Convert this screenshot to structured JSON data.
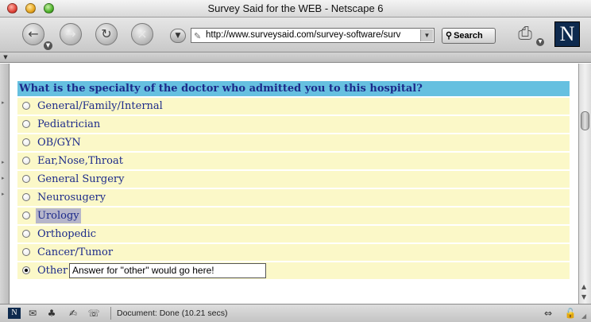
{
  "window": {
    "title": "Survey Said for the WEB - Netscape 6"
  },
  "toolbar": {
    "back_glyph": "←",
    "forward_glyph": "→",
    "reload_glyph": "↻",
    "stop_glyph": "×",
    "url": "http://www.surveysaid.com/survey-software/surv",
    "search_label": "Search"
  },
  "question": {
    "text": "What is the specialty of the doctor who admitted you to this hospital?",
    "options": [
      {
        "label": "General/Family/Internal"
      },
      {
        "label": "Pediatrician"
      },
      {
        "label": "OB/GYN"
      },
      {
        "label": "Ear,Nose,Throat"
      },
      {
        "label": "General Surgery"
      },
      {
        "label": "Neurosugery"
      },
      {
        "label": "Urology"
      },
      {
        "label": "Orthopedic"
      },
      {
        "label": "Cancer/Tumor"
      },
      {
        "label": "Other"
      }
    ],
    "selected": "Other",
    "other_value": "Answer for \"other\" would go here!"
  },
  "status": {
    "text": "Document: Done (10.21 secs)"
  },
  "colors": {
    "question_bg": "#66c0e0",
    "option_bg": "#fbf8c8",
    "text": "#1c2a8a"
  }
}
